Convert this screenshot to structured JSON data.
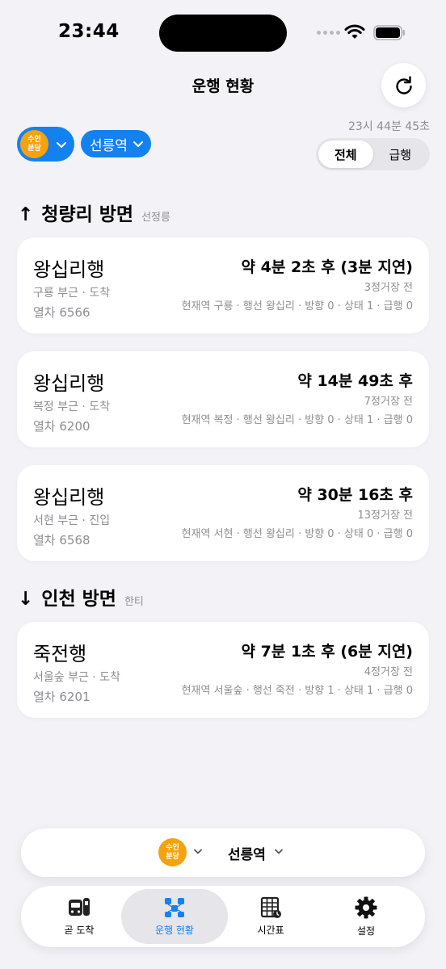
{
  "status_bar": {
    "time": "23:44"
  },
  "header": {
    "title": "운행 현황",
    "updated_time": "23시 44분 45초"
  },
  "line": {
    "badge_line1": "수인",
    "badge_line2": "분당",
    "color": "#f5a20e"
  },
  "station": {
    "name": "선릉역"
  },
  "filter": {
    "options": [
      "전체",
      "급행"
    ],
    "selected": "전체"
  },
  "accent_color": "#1481f1",
  "sections": [
    {
      "arrow": "↑",
      "title": "청량리 방면",
      "sub": "선정릉",
      "trains": [
        {
          "dest": "왕십리행",
          "location": "구룡 부근 · 도착",
          "train_no": "열차 6566",
          "eta": "약 4분 2초 후 (3분 지연)",
          "stops": "3정거장 전",
          "detail": "현재역 구룡 · 행선 왕십리 · 방향 0 · 상태 1 · 급행 0"
        },
        {
          "dest": "왕십리행",
          "location": "복정 부근 · 도착",
          "train_no": "열차 6200",
          "eta": "약 14분 49초 후",
          "stops": "7정거장 전",
          "detail": "현재역 복정 · 행선 왕십리 · 방향 0 · 상태 1 · 급행 0"
        },
        {
          "dest": "왕십리행",
          "location": "서현 부근 · 진입",
          "train_no": "열차 6568",
          "eta": "약 30분 16초 후",
          "stops": "13정거장 전",
          "detail": "현재역 서현 · 행선 왕십리 · 방향 0 · 상태 0 · 급행 0"
        }
      ]
    },
    {
      "arrow": "↓",
      "title": "인천 방면",
      "sub": "한티",
      "trains": [
        {
          "dest": "죽전행",
          "location": "서울숲 부근 · 도착",
          "train_no": "열차 6201",
          "eta": "약 7분 1초 후 (6분 지연)",
          "stops": "4정거장 전",
          "detail": "현재역 서울숲 · 행선 죽전 · 방향 1 · 상태 1 · 급행 0"
        }
      ]
    }
  ],
  "tabs": [
    {
      "label": "곧 도착",
      "icon": "train-front-icon"
    },
    {
      "label": "운행 현황",
      "icon": "route-map-icon"
    },
    {
      "label": "시간표",
      "icon": "timetable-icon"
    },
    {
      "label": "설정",
      "icon": "gear-icon"
    }
  ],
  "active_tab": "운행 현황"
}
